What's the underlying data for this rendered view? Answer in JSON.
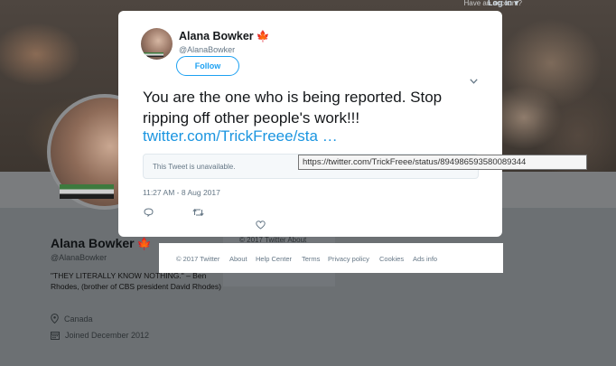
{
  "top_bar": {
    "have_account": "Have an account?",
    "login": "Log in ▾"
  },
  "profile": {
    "name": "Alana Bowker",
    "handle": "@AlanaBowker",
    "bio": "\"THEY LITERALLY KNOW NOTHING.\" – Ben Rhodes, (brother of CBS president David Rhodes)",
    "location": "Canada",
    "joined": "Joined December 2012",
    "side_footer": "© 2017 Twitter   About"
  },
  "tweet": {
    "author_name": "Alana Bowker",
    "author_handle": "@AlanaBowker",
    "follow_label": "Follow",
    "text": "You are the one who is being reported. Stop ripping off other people's work!!!",
    "link_text": "twitter.com/TrickFreee/sta …",
    "quote_unavailable": "This Tweet is unavailable.",
    "timestamp": "11:27 AM - 8 Aug 2017"
  },
  "tooltip": {
    "url": "https://twitter.com/TrickFreee/status/894986593580089344"
  },
  "footer": {
    "links": [
      "© 2017 Twitter",
      "About",
      "Help Center",
      "Terms",
      "Privacy policy",
      "Cookies",
      "Ads info"
    ]
  },
  "colors": {
    "link": "#1b95e0",
    "follow_accent": "#1da1f2",
    "maple_leaf": "#d52b1e"
  },
  "icons": [
    "maple-leaf-icon",
    "chevron-down-icon",
    "reply-icon",
    "retweet-icon",
    "heart-icon",
    "location-pin-icon",
    "calendar-icon"
  ]
}
